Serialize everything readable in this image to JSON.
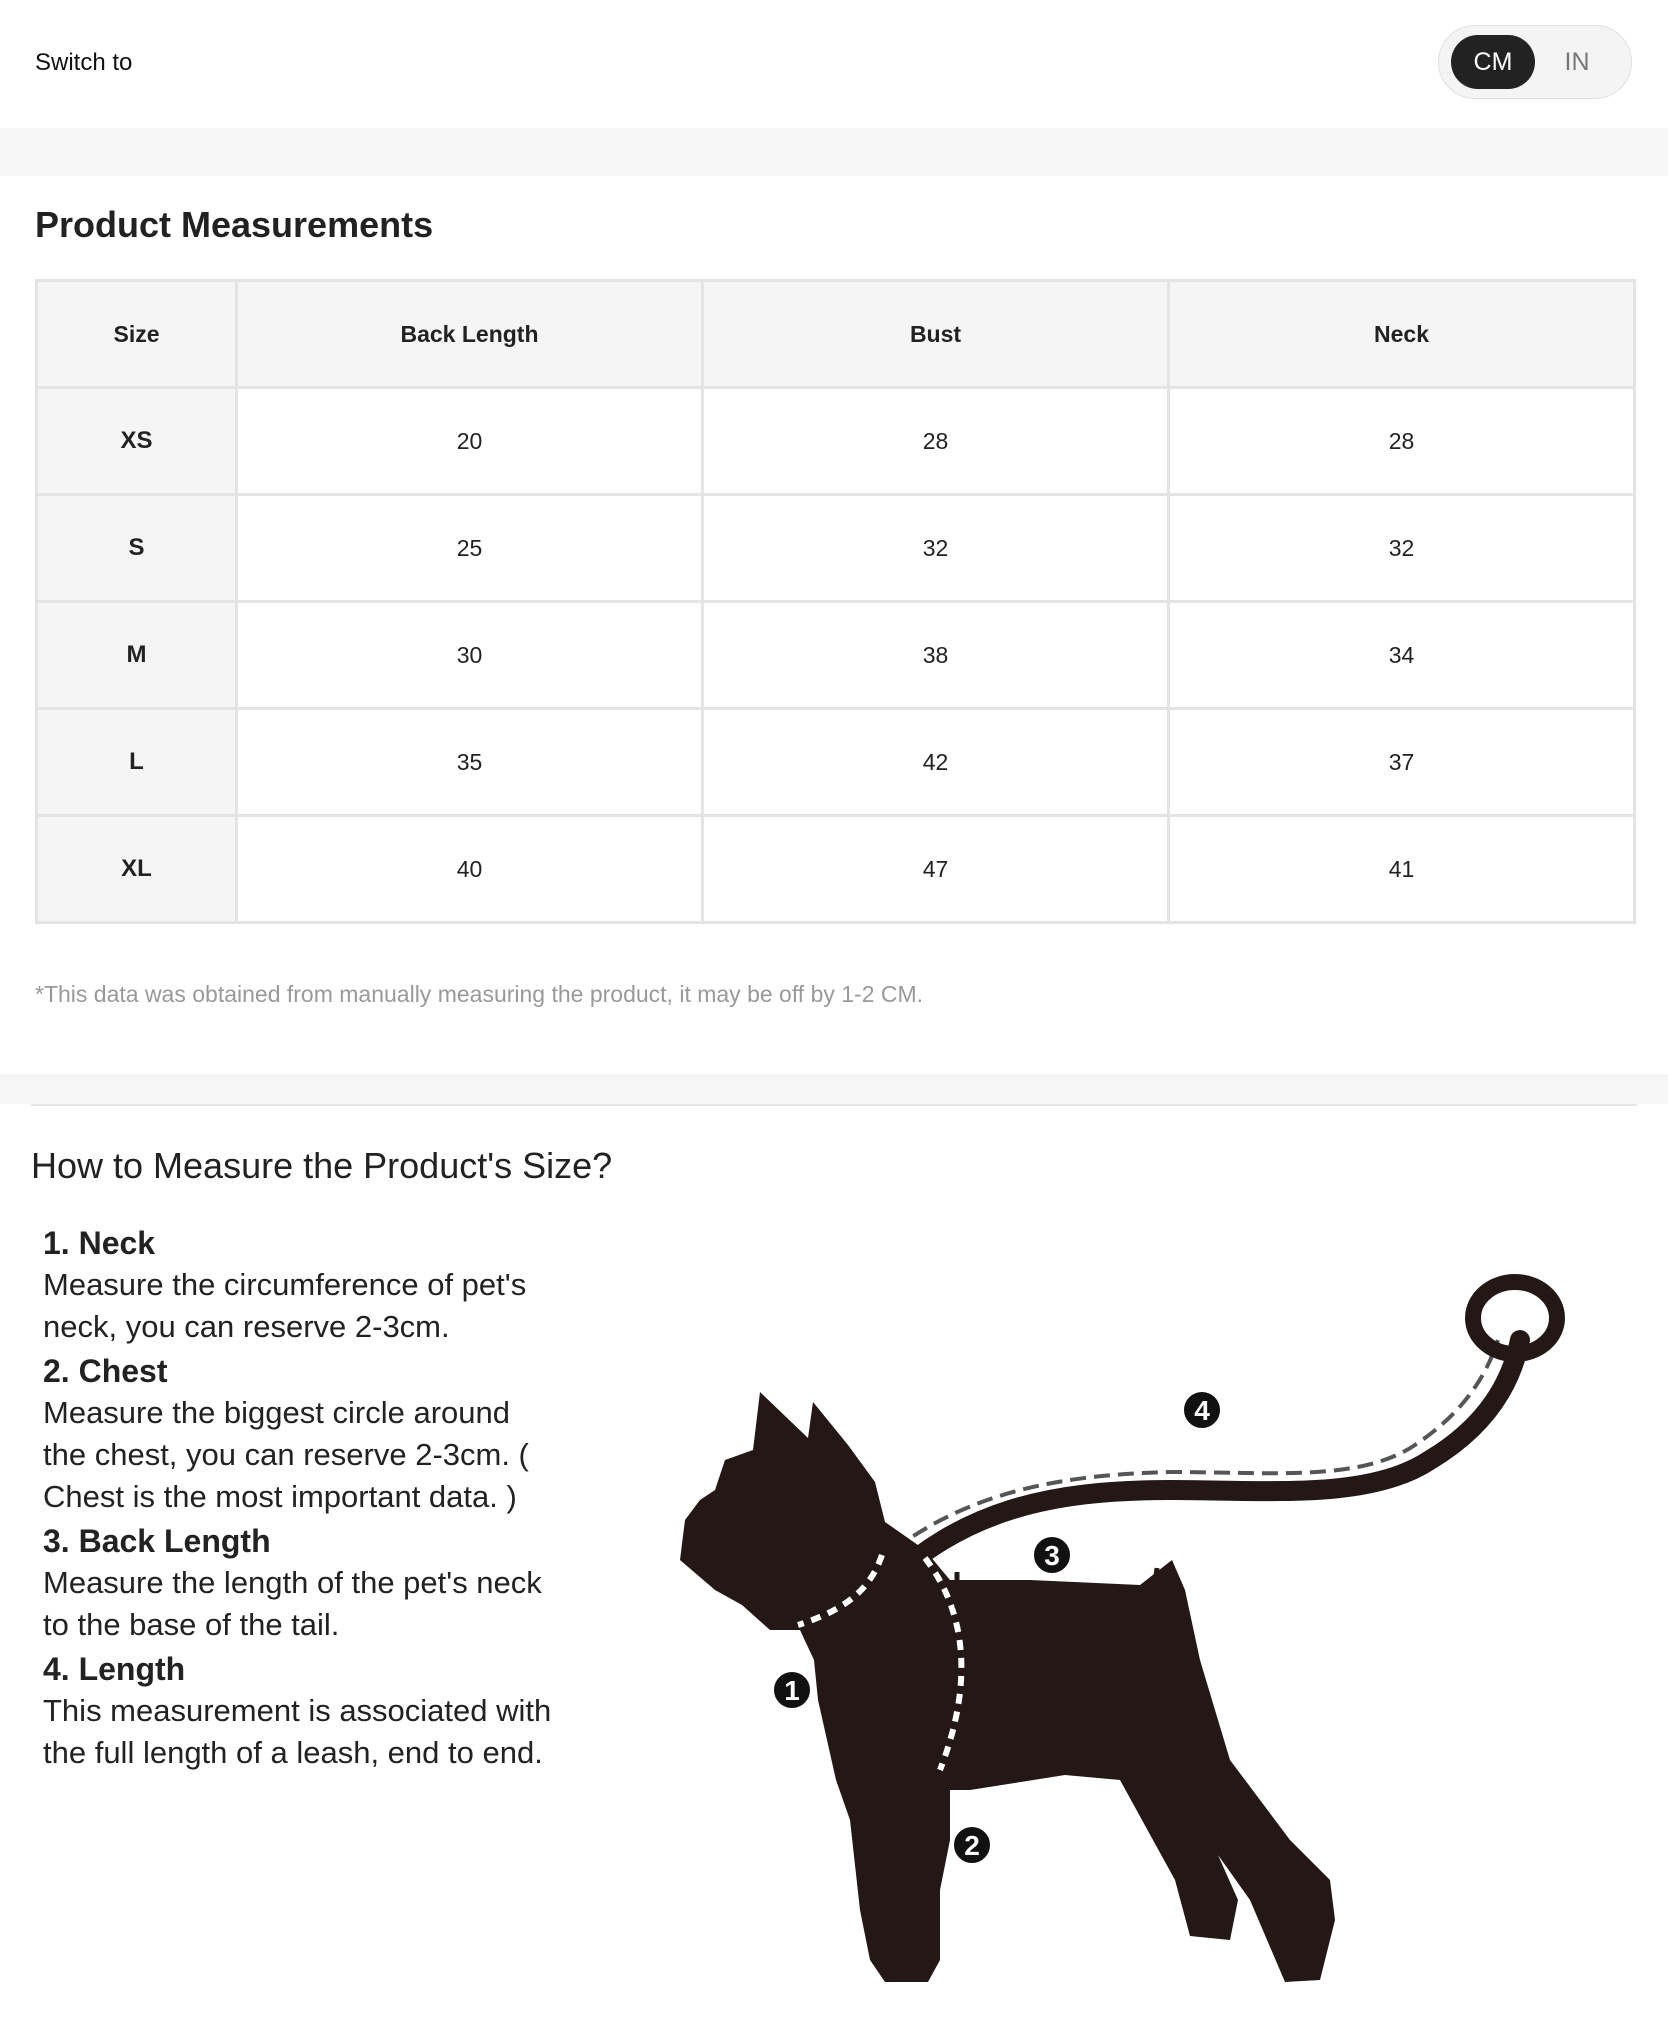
{
  "unit_switch": {
    "label": "Switch to",
    "options": [
      "CM",
      "IN"
    ],
    "selected": "CM"
  },
  "measurements": {
    "title": "Product Measurements",
    "columns": [
      "Size",
      "Back Length",
      "Bust",
      "Neck"
    ],
    "rows": [
      {
        "size": "XS",
        "back_length": "20",
        "bust": "28",
        "neck": "28"
      },
      {
        "size": "S",
        "back_length": "25",
        "bust": "32",
        "neck": "32"
      },
      {
        "size": "M",
        "back_length": "30",
        "bust": "38",
        "neck": "34"
      },
      {
        "size": "L",
        "back_length": "35",
        "bust": "42",
        "neck": "37"
      },
      {
        "size": "XL",
        "back_length": "40",
        "bust": "47",
        "neck": "41"
      }
    ],
    "note": "*This data was obtained from manually measuring the product, it may be off by 1-2 CM."
  },
  "how_to": {
    "title": "How to Measure the Product's Size?",
    "steps": [
      {
        "heading": "1. Neck",
        "lines": [
          "Measure the circumference of pet's",
          "neck, you can reserve 2-3cm."
        ]
      },
      {
        "heading": "2. Chest",
        "lines": [
          "Measure the biggest circle around",
          "the chest, you can reserve 2-3cm. (",
          "Chest is the most important data. )"
        ]
      },
      {
        "heading": "3. Back Length",
        "lines": [
          "Measure the length of the pet's neck",
          "to the base of the tail."
        ]
      },
      {
        "heading": "4. Length",
        "lines": [
          "This measurement is associated with",
          "the full length of a leash, end to end."
        ]
      }
    ],
    "diagram_markers": [
      "1",
      "2",
      "3",
      "4"
    ]
  }
}
